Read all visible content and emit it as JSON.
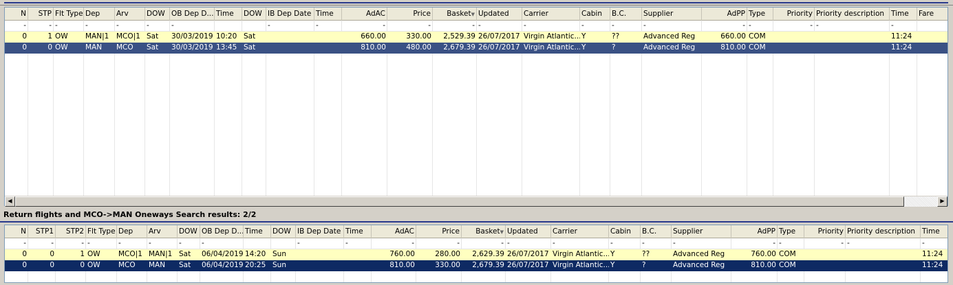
{
  "top_grid": {
    "columns": [
      {
        "label": "N",
        "w": 34,
        "align": "r"
      },
      {
        "label": "STP",
        "w": 37,
        "align": "r"
      },
      {
        "label": "Flt Type",
        "w": 44,
        "align": "l"
      },
      {
        "label": "Dep",
        "w": 45,
        "align": "l"
      },
      {
        "label": "Arv",
        "w": 44,
        "align": "l"
      },
      {
        "label": "DOW",
        "w": 36,
        "align": "l"
      },
      {
        "label": "OB Dep D...",
        "w": 65,
        "align": "l"
      },
      {
        "label": "Time",
        "w": 40,
        "align": "l"
      },
      {
        "label": "DOW",
        "w": 35,
        "align": "l"
      },
      {
        "label": "IB Dep Date",
        "w": 70,
        "align": "l"
      },
      {
        "label": "Time",
        "w": 40,
        "align": "l"
      },
      {
        "label": "AdAC",
        "w": 66,
        "align": "r"
      },
      {
        "label": "Price",
        "w": 66,
        "align": "r"
      },
      {
        "label": "Basket",
        "w": 64,
        "align": "r",
        "sorted": true
      },
      {
        "label": "Updated",
        "w": 66,
        "align": "l"
      },
      {
        "label": "Carrier",
        "w": 84,
        "align": "l"
      },
      {
        "label": "Cabin",
        "w": 44,
        "align": "l"
      },
      {
        "label": "B.C.",
        "w": 46,
        "align": "l"
      },
      {
        "label": "Supplier",
        "w": 87,
        "align": "l"
      },
      {
        "label": "AdPP",
        "w": 66,
        "align": "r"
      },
      {
        "label": "Type",
        "w": 38,
        "align": "l"
      },
      {
        "label": "Priority",
        "w": 60,
        "align": "r"
      },
      {
        "label": "Priority description",
        "w": 109,
        "align": "l"
      },
      {
        "label": "Time",
        "w": 40,
        "align": "l"
      },
      {
        "label": "Fare",
        "w": 45,
        "align": "l"
      }
    ],
    "filter_row": [
      "-",
      "-",
      "-",
      "-",
      "-",
      "-",
      "-",
      "",
      "",
      "-",
      "-",
      "-",
      "-",
      "-",
      "-",
      "-",
      "-",
      "-",
      "-",
      "-",
      "-",
      "-",
      "-",
      "-",
      ""
    ],
    "rows": [
      {
        "style": "yellow",
        "cells": [
          "0",
          "1",
          "OW",
          "MAN|1",
          "MCO|1",
          "Sat",
          "30/03/2019",
          "10:20",
          "Sat",
          "",
          "",
          "660.00",
          "330.00",
          "2,529.39",
          "26/07/2017",
          "Virgin Atlantic...",
          "Y",
          "??",
          "Advanced Reg",
          "660.00",
          "COM",
          "",
          "",
          "11:24",
          ""
        ]
      },
      {
        "style": "selected",
        "cells": [
          "0",
          "0",
          "OW",
          "MAN",
          "MCO",
          "Sat",
          "30/03/2019",
          "13:45",
          "Sat",
          "",
          "",
          "810.00",
          "480.00",
          "2,679.39",
          "26/07/2017",
          "Virgin Atlantic...",
          "Y",
          "?",
          "Advanced Reg",
          "810.00",
          "COM",
          "",
          "",
          "11:24",
          ""
        ]
      }
    ]
  },
  "section_label": "Return flights and MCO->MAN Oneways Search results: 2/2",
  "bottom_grid": {
    "columns": [
      {
        "label": "N",
        "w": 34,
        "align": "r"
      },
      {
        "label": "STP1",
        "w": 40,
        "align": "r"
      },
      {
        "label": "STP2",
        "w": 44,
        "align": "r"
      },
      {
        "label": "Flt Type",
        "w": 45,
        "align": "l"
      },
      {
        "label": "Dep",
        "w": 44,
        "align": "l"
      },
      {
        "label": "Arv",
        "w": 44,
        "align": "l"
      },
      {
        "label": "DOW",
        "w": 33,
        "align": "l"
      },
      {
        "label": "OB Dep D...",
        "w": 63,
        "align": "l"
      },
      {
        "label": "Time",
        "w": 40,
        "align": "l"
      },
      {
        "label": "DOW",
        "w": 36,
        "align": "l"
      },
      {
        "label": "IB Dep Date",
        "w": 70,
        "align": "l"
      },
      {
        "label": "Time",
        "w": 40,
        "align": "l"
      },
      {
        "label": "AdAC",
        "w": 65,
        "align": "r"
      },
      {
        "label": "Price",
        "w": 66,
        "align": "r"
      },
      {
        "label": "Basket",
        "w": 64,
        "align": "r",
        "sorted": true
      },
      {
        "label": "Updated",
        "w": 66,
        "align": "l"
      },
      {
        "label": "Carrier",
        "w": 84,
        "align": "l"
      },
      {
        "label": "Cabin",
        "w": 46,
        "align": "l"
      },
      {
        "label": "B.C.",
        "w": 45,
        "align": "l"
      },
      {
        "label": "Supplier",
        "w": 87,
        "align": "l"
      },
      {
        "label": "AdPP",
        "w": 67,
        "align": "r"
      },
      {
        "label": "Type",
        "w": 39,
        "align": "l"
      },
      {
        "label": "Priority",
        "w": 60,
        "align": "r"
      },
      {
        "label": "Priority description",
        "w": 109,
        "align": "l"
      },
      {
        "label": "Time",
        "w": 45,
        "align": "l"
      }
    ],
    "filter_row": [
      "-",
      "-",
      "-",
      "-",
      "-",
      "-",
      "-",
      "-",
      "",
      "",
      "-",
      "-",
      "-",
      "-",
      "-",
      "-",
      "-",
      "-",
      "-",
      "-",
      "-",
      "-",
      "-",
      "-",
      "-"
    ],
    "rows": [
      {
        "style": "yellow",
        "cells": [
          "0",
          "0",
          "1",
          "OW",
          "MCO|1",
          "MAN|1",
          "Sat",
          "06/04/2019",
          "14:20",
          "Sun",
          "",
          "",
          "760.00",
          "280.00",
          "2,629.39",
          "26/07/2017",
          "Virgin Atlantic...",
          "Y",
          "??",
          "Advanced Reg",
          "760.00",
          "COM",
          "",
          "",
          "11:24"
        ]
      },
      {
        "style": "selected2",
        "cells": [
          "0",
          "0",
          "0",
          "OW",
          "MCO",
          "MAN",
          "Sat",
          "06/04/2019",
          "20:25",
          "Sun",
          "",
          "",
          "810.00",
          "330.00",
          "2,679.39",
          "26/07/2017",
          "Virgin Atlantic...",
          "Y",
          "?",
          "Advanced Reg",
          "810.00",
          "COM",
          "",
          "",
          "11:24"
        ]
      }
    ]
  },
  "colors": {
    "row_highlight": "#ffffc0",
    "row_selected_top": "#3a5184",
    "row_selected_bottom": "#0e2a63",
    "accent_line": "#2a3a8c"
  },
  "icons": {
    "scroll_left": "scroll-left-arrow-icon",
    "scroll_right": "scroll-right-arrow-icon",
    "sort_desc": "sort-descending-icon"
  }
}
